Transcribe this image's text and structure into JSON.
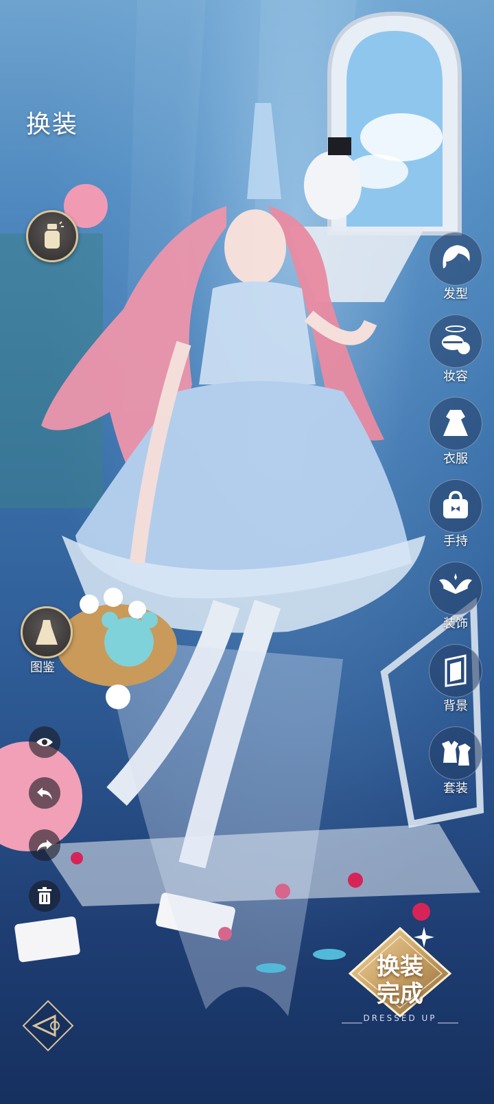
{
  "page": {
    "title": "换装"
  },
  "menu": {
    "items": [
      {
        "id": "hair",
        "label": "发型",
        "icon": "hair-icon"
      },
      {
        "id": "makeup",
        "label": "妆容",
        "icon": "makeup-icon"
      },
      {
        "id": "clothes",
        "label": "衣服",
        "icon": "dress-icon"
      },
      {
        "id": "handheld",
        "label": "手持",
        "icon": "handbag-icon"
      },
      {
        "id": "accessory",
        "label": "装饰",
        "icon": "wings-icon"
      },
      {
        "id": "background",
        "label": "背景",
        "icon": "background-icon"
      },
      {
        "id": "suit",
        "label": "套装",
        "icon": "suit-icon"
      }
    ]
  },
  "left_tools": {
    "catalog_label": "图鉴",
    "perfume_icon": "perfume-icon",
    "catalog_icon": "dress-catalog-icon"
  },
  "controls": {
    "visibility_icon": "eye-icon",
    "undo_icon": "undo-icon",
    "redo_icon": "redo-icon",
    "delete_icon": "trash-icon",
    "back_icon": "back-arrow-icon"
  },
  "done_button": {
    "line1": "换装",
    "line2": "完成",
    "subtitle": "DRESSED UP"
  },
  "colors": {
    "accent_gold": "#d8c49a",
    "menu_bg": "#233c64",
    "done_gold": "#c9a063"
  }
}
